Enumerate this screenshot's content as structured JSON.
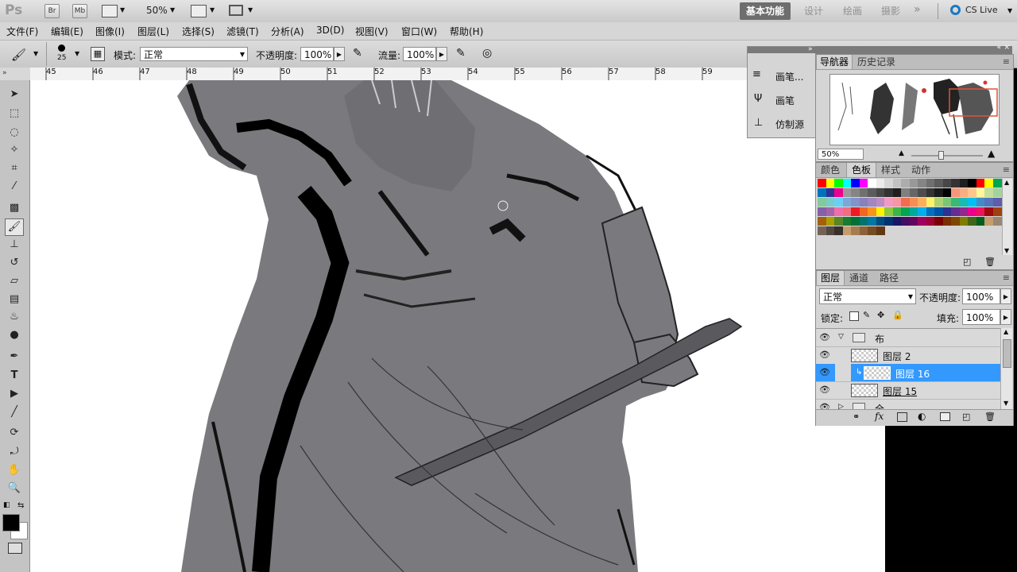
{
  "app": {
    "logo": "Ps",
    "bridge": "Br",
    "minibridge": "Mb",
    "zoom": "50%"
  },
  "workspaces": [
    {
      "label": "基本功能",
      "active": true
    },
    {
      "label": "设计",
      "active": false
    },
    {
      "label": "绘画",
      "active": false
    },
    {
      "label": "摄影",
      "active": false
    }
  ],
  "cs_live": "CS Live",
  "menu": [
    "文件(F)",
    "编辑(E)",
    "图像(I)",
    "图层(L)",
    "选择(S)",
    "滤镜(T)",
    "分析(A)",
    "3D(D)",
    "视图(V)",
    "窗口(W)",
    "帮助(H)"
  ],
  "options": {
    "brush_size": "25",
    "mode_label": "模式:",
    "mode_value": "正常",
    "opacity_label": "不透明度:",
    "opacity_value": "100%",
    "flow_label": "流量:",
    "flow_value": "100%"
  },
  "ruler_ticks": [
    "45",
    "46",
    "47",
    "48",
    "49",
    "50",
    "51",
    "52",
    "53",
    "54",
    "55",
    "56",
    "57",
    "58",
    "59"
  ],
  "brush_panel": [
    {
      "label": "画笔...",
      "icon": "brush-preset-icon"
    },
    {
      "label": "画笔",
      "icon": "brush-icon"
    },
    {
      "label": "仿制源",
      "icon": "clone-source-icon"
    }
  ],
  "navigator": {
    "tabs": [
      "导航器",
      "历史记录"
    ],
    "zoom": "50%"
  },
  "color_panel": {
    "tabs": [
      "颜色",
      "色板",
      "样式",
      "动作"
    ],
    "swatch_rows": [
      [
        "#ff0000",
        "#ffff00",
        "#00ff00",
        "#00ffff",
        "#0000ff",
        "#ff00ff",
        "#ffffff",
        "#ebebeb",
        "#d6d6d6",
        "#c2c2c2",
        "#adadad",
        "#999999",
        "#858585",
        "#707070",
        "#5c5c5c",
        "#474747",
        "#333333",
        "#1f1f1f",
        "#000000",
        "#ff0000",
        "#ffff00",
        "#00a651"
      ],
      [
        "#0072bc",
        "#2e3192",
        "#ec008c",
        "#999999",
        "#858585",
        "#707070",
        "#5c5c5c",
        "#474747",
        "#333333",
        "#1f1f1f",
        "#7f7f7f",
        "#666666",
        "#4d4d4d",
        "#333333",
        "#1a1a1a",
        "#000000",
        "#f7977a",
        "#f9ad81",
        "#fdc68a",
        "#fff79a",
        "#c4df9b",
        "#a3d39c"
      ],
      [
        "#82ca9c",
        "#7accc8",
        "#6dcff6",
        "#7da7d9",
        "#8393ca",
        "#8781bd",
        "#a187be",
        "#bc8dbf",
        "#f49ac2",
        "#f6989d",
        "#f26c4f",
        "#f68e55",
        "#fbaf5c",
        "#fff467",
        "#acd372",
        "#7cc576",
        "#3bb878",
        "#1abbb4",
        "#00bff3",
        "#438ccb",
        "#5574b9",
        "#605ca8"
      ],
      [
        "#855fa8",
        "#a763a8",
        "#f06eaa",
        "#f26d7d",
        "#ed1c24",
        "#f26522",
        "#f7941d",
        "#fff200",
        "#8dc73f",
        "#39b54a",
        "#00a651",
        "#00a99d",
        "#00aeef",
        "#0072bc",
        "#0054a6",
        "#2e3192",
        "#662d91",
        "#92278f",
        "#ec008c",
        "#ed145b",
        "#9e0b0f",
        "#a0410d"
      ],
      [
        "#a3620a",
        "#aba000",
        "#598527",
        "#197b30",
        "#007236",
        "#00746b",
        "#0076a3",
        "#004b80",
        "#003471",
        "#1b1464",
        "#440e62",
        "#630460",
        "#9e005d",
        "#9e0039",
        "#790000",
        "#7b2e00",
        "#7d4900",
        "#827b00",
        "#406618",
        "#005e20",
        "#c69c6d",
        "#998675"
      ],
      [
        "#736357",
        "#534741",
        "#37302d",
        "#c69c6d",
        "#a67c52",
        "#8c6239",
        "#754c24",
        "#603913"
      ]
    ]
  },
  "layers_panel": {
    "tabs": [
      "图层",
      "通道",
      "路径"
    ],
    "blend_mode": "正常",
    "opacity_label": "不透明度:",
    "opacity_value": "100%",
    "lock_label": "锁定:",
    "fill_label": "填充:",
    "fill_value": "100%",
    "layers": [
      {
        "name": "布",
        "type": "group"
      },
      {
        "name": "图层 2",
        "type": "layer"
      },
      {
        "name": "图层 16",
        "type": "layer",
        "selected": true
      },
      {
        "name": "图层 15",
        "type": "layer"
      },
      {
        "name": "全",
        "type": "group"
      }
    ]
  }
}
